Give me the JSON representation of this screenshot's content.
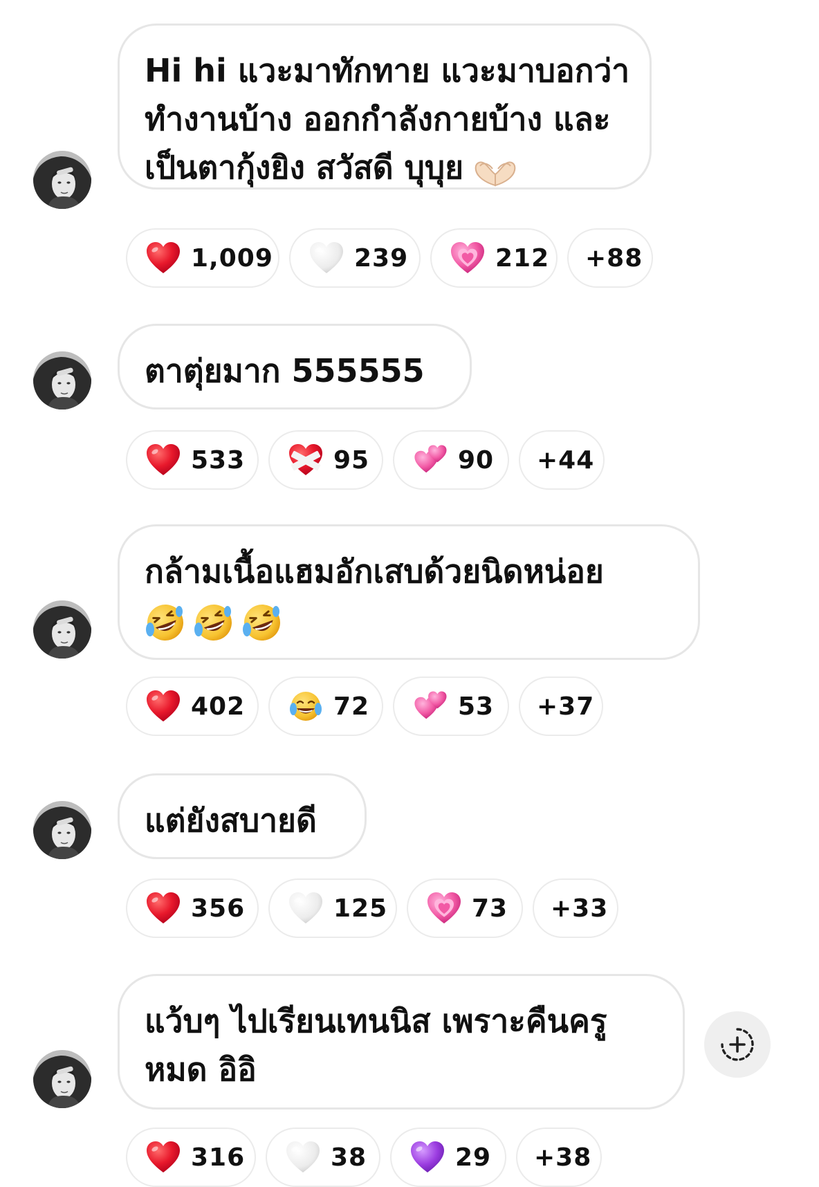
{
  "messages": [
    {
      "lines": [
        "Hi hi แวะมาทักทาย แวะมาบอกว่า",
        "ทำงานบ้าง ออกกำลังกายบ้าง และ",
        "เป็นตากุ้งยิง สวัสดี บุบุย"
      ],
      "trailing_emoji": "heart-hands-emoji",
      "reactions": [
        {
          "emoji": "red-heart",
          "color": "#e8192c",
          "count": "1,009"
        },
        {
          "emoji": "white-heart",
          "color": "#eeeeee",
          "count": "239"
        },
        {
          "emoji": "growing-heart",
          "color": "#f25aa5",
          "count": "212"
        }
      ],
      "more": "+88"
    },
    {
      "lines": [
        "ตาตุ่ยมาก 555555"
      ],
      "reactions": [
        {
          "emoji": "red-heart",
          "color": "#e8192c",
          "count": "533"
        },
        {
          "emoji": "mending-heart",
          "color": "#e8192c",
          "count": "95"
        },
        {
          "emoji": "two-hearts",
          "color": "#f05aa8",
          "count": "90"
        }
      ],
      "more": "+44"
    },
    {
      "lines": [
        "กล้ามเนื้อแฮมอักเสบด้วยนิดหน่อย"
      ],
      "emoji_line": [
        "rofl-emoji",
        "rofl-emoji",
        "rofl-emoji"
      ],
      "reactions": [
        {
          "emoji": "red-heart",
          "color": "#e8192c",
          "count": "402"
        },
        {
          "emoji": "joy-face",
          "color": "#f7c331",
          "count": "72"
        },
        {
          "emoji": "two-hearts",
          "color": "#f05aa8",
          "count": "53"
        }
      ],
      "more": "+37"
    },
    {
      "lines": [
        "แต่ยังสบายดี"
      ],
      "reactions": [
        {
          "emoji": "red-heart",
          "color": "#e8192c",
          "count": "356"
        },
        {
          "emoji": "white-heart",
          "color": "#eeeeee",
          "count": "125"
        },
        {
          "emoji": "growing-heart",
          "color": "#f25aa5",
          "count": "73"
        }
      ],
      "more": "+33"
    },
    {
      "lines": [
        "แว้บๆ ไปเรียนเทนนิส เพราะคืนครู",
        "หมด อิอิ"
      ],
      "reactions": [
        {
          "emoji": "red-heart",
          "color": "#e8192c",
          "count": "316"
        },
        {
          "emoji": "white-heart",
          "color": "#eeeeee",
          "count": "38"
        },
        {
          "emoji": "purple-heart",
          "color": "#9b3ce0",
          "count": "29"
        }
      ],
      "more": "+38"
    }
  ],
  "add_reaction_icon": "add-reaction-icon"
}
